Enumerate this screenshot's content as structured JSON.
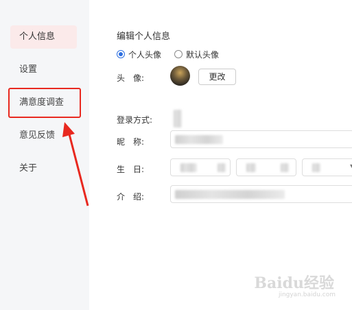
{
  "sidebar": {
    "items": [
      {
        "label": "个人信息",
        "active": true
      },
      {
        "label": "设置"
      },
      {
        "label": "满意度调查"
      },
      {
        "label": "意见反馈"
      },
      {
        "label": "关于"
      }
    ]
  },
  "profile": {
    "title": "编辑个人信息",
    "avatar_options": {
      "custom": "个人头像",
      "default": "默认头像",
      "selected": "custom"
    },
    "avatar_label": "头　像:",
    "change_button": "更改",
    "login_label": "登录方式:",
    "nickname_label": "昵　称:",
    "birthday_label": "生　日:",
    "intro_label": "介　绍:"
  },
  "watermark": {
    "brand": "Baidu经验",
    "url": "jingyan.baidu.com"
  },
  "colors": {
    "accent": "#2d6fe0",
    "highlight": "#e8281f",
    "sidebar_active": "#fbeaea"
  }
}
